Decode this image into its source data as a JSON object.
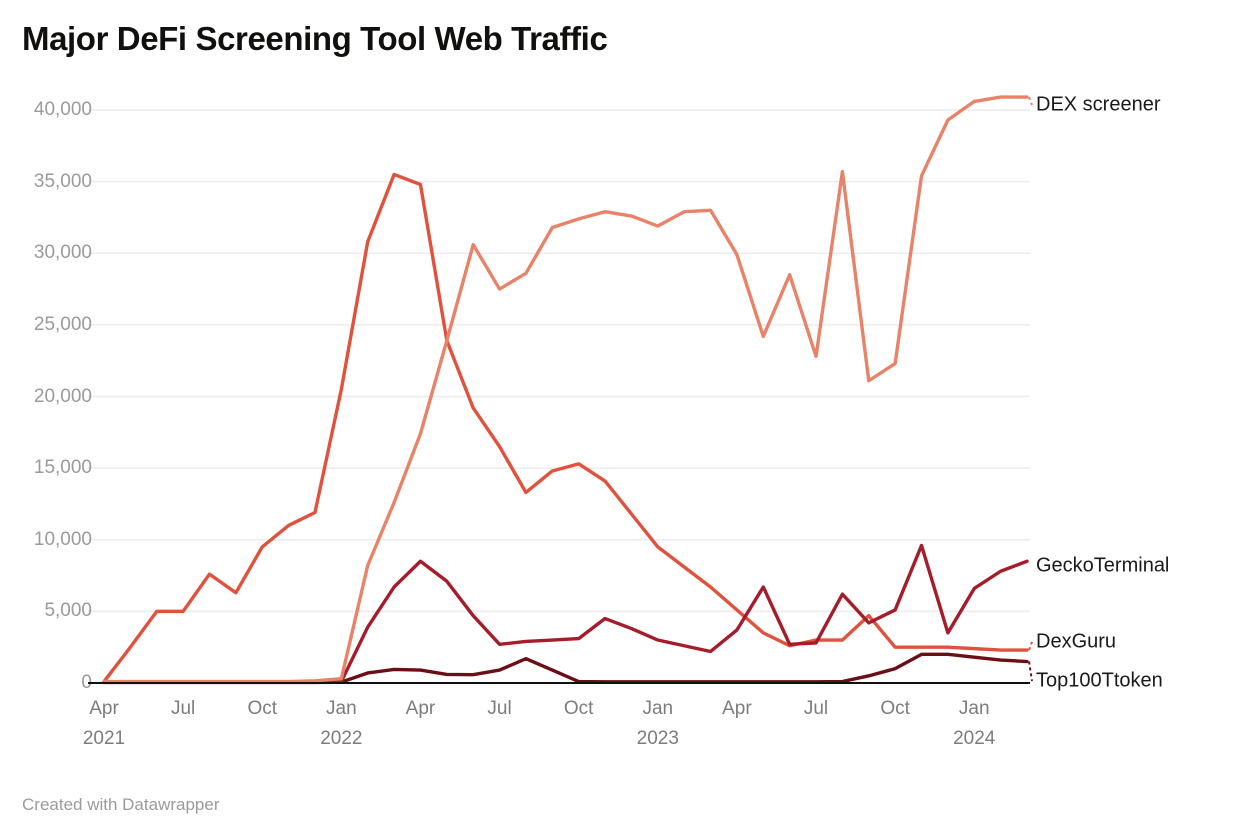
{
  "header": {
    "title": "Major DeFi Screening Tool Web Traffic"
  },
  "footer": {
    "credit": "Created with Datawrapper"
  },
  "chart_data": {
    "type": "line",
    "title": "Major DeFi Screening Tool Web Traffic",
    "xlabel": "",
    "ylabel": "",
    "ylim": [
      0,
      42000
    ],
    "grid": true,
    "legend_position": "right-inline",
    "y_ticks": [
      0,
      5000,
      10000,
      15000,
      20000,
      25000,
      30000,
      35000,
      40000
    ],
    "y_tick_labels": [
      "0",
      "5,000",
      "10,000",
      "15,000",
      "20,000",
      "25,000",
      "30,000",
      "35,000",
      "40,000"
    ],
    "x_ticks": [
      {
        "label": "Apr",
        "year": "2021",
        "index": 0
      },
      {
        "label": "Jul",
        "year": "",
        "index": 3
      },
      {
        "label": "Oct",
        "year": "",
        "index": 6
      },
      {
        "label": "Jan",
        "year": "2022",
        "index": 9
      },
      {
        "label": "Apr",
        "year": "",
        "index": 12
      },
      {
        "label": "Jul",
        "year": "",
        "index": 15
      },
      {
        "label": "Oct",
        "year": "",
        "index": 18
      },
      {
        "label": "Jan",
        "year": "2023",
        "index": 21
      },
      {
        "label": "Apr",
        "year": "",
        "index": 24
      },
      {
        "label": "Jul",
        "year": "",
        "index": 27
      },
      {
        "label": "Oct",
        "year": "",
        "index": 30
      },
      {
        "label": "Jan",
        "year": "2024",
        "index": 33
      }
    ],
    "x": [
      "2021-04",
      "2021-05",
      "2021-06",
      "2021-07",
      "2021-08",
      "2021-09",
      "2021-10",
      "2021-11",
      "2021-12",
      "2022-01",
      "2022-02",
      "2022-03",
      "2022-04",
      "2022-05",
      "2022-06",
      "2022-07",
      "2022-08",
      "2022-09",
      "2022-10",
      "2022-11",
      "2022-12",
      "2023-01",
      "2023-02",
      "2023-03",
      "2023-04",
      "2023-05",
      "2023-06",
      "2023-07",
      "2023-08",
      "2023-09",
      "2023-10",
      "2023-11",
      "2023-12",
      "2024-01",
      "2024-02",
      "2024-03"
    ],
    "series": [
      {
        "name": "DEX screener",
        "color": "#e8836a",
        "values": [
          100,
          100,
          100,
          100,
          100,
          100,
          100,
          100,
          150,
          300,
          8200,
          12600,
          17400,
          23900,
          30600,
          27500,
          28600,
          31800,
          32400,
          32900,
          32600,
          31900,
          32900,
          33000,
          29900,
          24200,
          28500,
          22800,
          35700,
          21100,
          22300,
          35400,
          39300,
          40600,
          40900,
          40900
        ]
      },
      {
        "name": "GeckoTerminal",
        "color": "#a51c2a",
        "values": [
          60,
          60,
          60,
          60,
          60,
          60,
          60,
          60,
          60,
          100,
          3900,
          6700,
          8500,
          7100,
          4700,
          2700,
          2900,
          3000,
          3100,
          4500,
          3800,
          3000,
          2600,
          2200,
          3700,
          6700,
          2700,
          2800,
          6200,
          4200,
          5100,
          9600,
          3500,
          6600,
          7800,
          8500
        ]
      },
      {
        "name": "DexGuru",
        "color": "#e0523e",
        "values": [
          100,
          2500,
          5000,
          5000,
          7600,
          6300,
          9500,
          11000,
          11900,
          20500,
          30800,
          35500,
          34800,
          23900,
          19200,
          16500,
          13300,
          14800,
          15300,
          14100,
          11800,
          9500,
          8100,
          6700,
          5100,
          3500,
          2600,
          3000,
          3000,
          4700,
          2500,
          2500,
          2500,
          2400,
          2300,
          2300
        ]
      },
      {
        "name": "Top100Ttoken",
        "color": "#6b0f16",
        "values": [
          40,
          40,
          40,
          40,
          40,
          40,
          40,
          40,
          40,
          60,
          700,
          950,
          900,
          600,
          580,
          900,
          1700,
          900,
          100,
          80,
          80,
          80,
          80,
          80,
          80,
          80,
          80,
          80,
          100,
          500,
          1000,
          2000,
          2000,
          1800,
          1600,
          1500
        ]
      }
    ],
    "series_labels": [
      {
        "name": "DEX screener",
        "color": "#1a1a1a"
      },
      {
        "name": "GeckoTerminal",
        "color": "#1a1a1a"
      },
      {
        "name": "DexGuru",
        "color": "#1a1a1a"
      },
      {
        "name": "Top100Ttoken",
        "color": "#1a1a1a"
      }
    ]
  }
}
